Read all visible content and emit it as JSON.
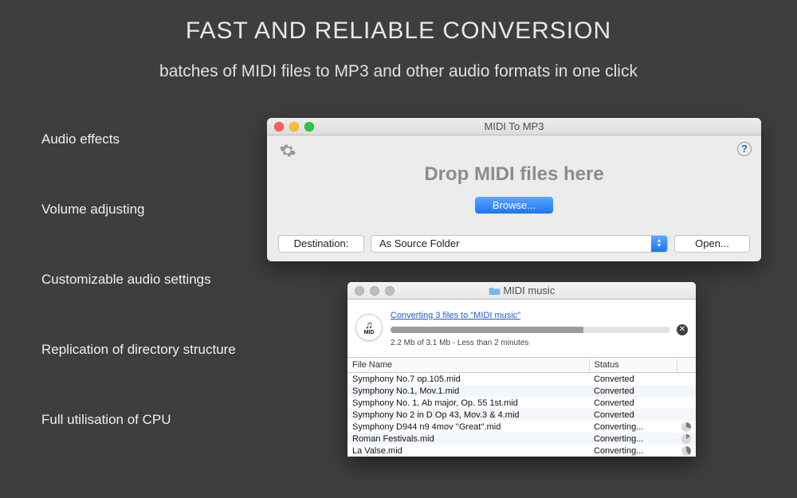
{
  "headline": "FAST AND RELIABLE CONVERSION",
  "subhead": "batches of MIDI files to MP3 and other audio formats in one click",
  "features": [
    "Audio effects",
    "Volume adjusting",
    "Customizable audio settings",
    "Replication of directory structure",
    "Full utilisation of CPU"
  ],
  "main_window": {
    "title": "MIDI To MP3",
    "drop_label": "Drop MIDI files here",
    "browse": "Browse...",
    "destination_label": "Destination:",
    "destination_value": "As Source Folder",
    "open": "Open..."
  },
  "progress_window": {
    "title": "MIDI music",
    "badge_text": "MID",
    "link": "Converting 3 files to \"MIDI music\"",
    "progress_pct": 69,
    "sub": "2.2 Mb of 3.1 Mb - Less than 2 minutes",
    "col_file": "File Name",
    "col_status": "Status",
    "rows": [
      {
        "name": "Symphony No.7 op.105.mid",
        "status": "Converted",
        "pie": null
      },
      {
        "name": "Symphony No.1, Mov.1.mid",
        "status": "Converted",
        "pie": null
      },
      {
        "name": "Symphony No. 1, Ab major, Op. 55 1st.mid",
        "status": "Converted",
        "pie": null
      },
      {
        "name": "Symphony No 2 in D Op 43, Mov.3 & 4.mid",
        "status": "Converted",
        "pie": null
      },
      {
        "name": "Symphony D944 n9 4mov ''Great''.mid",
        "status": "Converting...",
        "pie": 30
      },
      {
        "name": "Roman Festivals.mid",
        "status": "Converting...",
        "pie": 15
      },
      {
        "name": "La Valse.mid",
        "status": "Converting...",
        "pie": 40
      }
    ]
  }
}
